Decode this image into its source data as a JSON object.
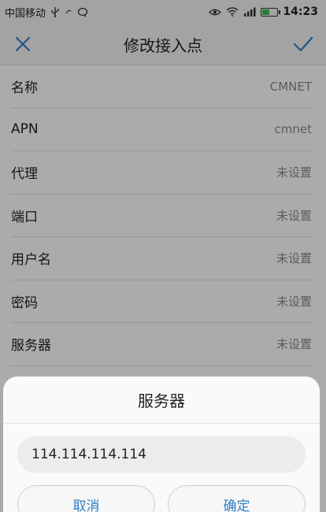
{
  "status_bar": {
    "carrier": "中国移动",
    "time": "14:23"
  },
  "header": {
    "title": "修改接入点",
    "close_icon": "close-icon",
    "confirm_icon": "check-icon",
    "accent_color": "#2d7fc7"
  },
  "settings": [
    {
      "label": "名称",
      "value": "CMNET"
    },
    {
      "label": "APN",
      "value": "cmnet"
    },
    {
      "label": "代理",
      "value": "未设置"
    },
    {
      "label": "端口",
      "value": "未设置"
    },
    {
      "label": "用户名",
      "value": "未设置"
    },
    {
      "label": "密码",
      "value": "未设置"
    },
    {
      "label": "服务器",
      "value": "未设置"
    }
  ],
  "dialog": {
    "title": "服务器",
    "input_value": "114.114.114.114",
    "cancel_label": "取消",
    "ok_label": "确定"
  }
}
